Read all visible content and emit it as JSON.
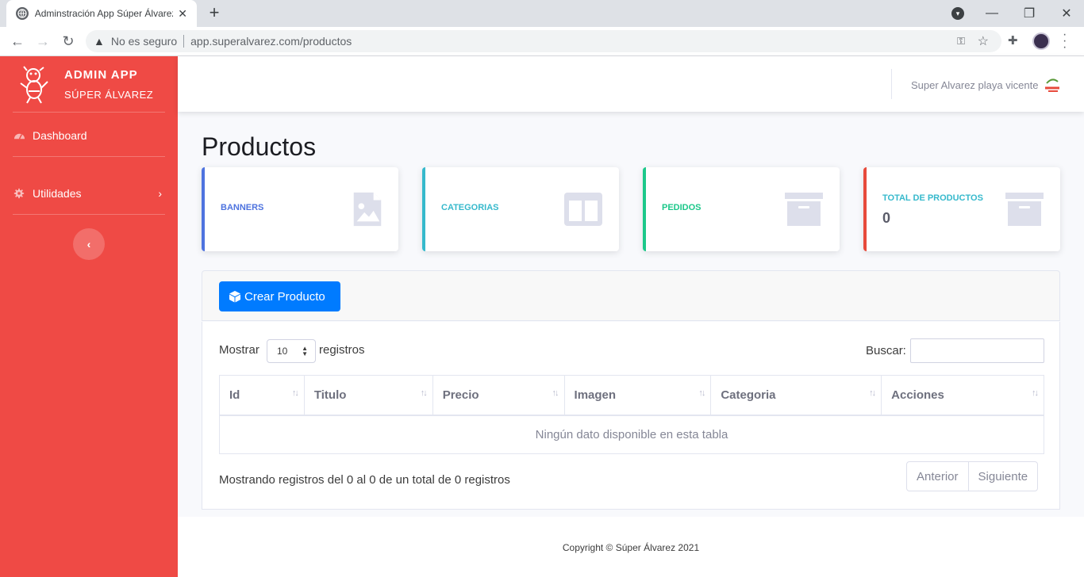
{
  "browser": {
    "tab_title": "Adminstración App Súper Álvarez",
    "not_secure": "No es seguro",
    "url": "app.superalvarez.com/productos"
  },
  "sidebar": {
    "brand_title": "ADMIN APP",
    "brand_subtitle": "SÚPER ÁLVAREZ",
    "items": [
      {
        "label": "Dashboard",
        "icon": "tachometer-icon"
      },
      {
        "label": "Utilidades",
        "icon": "gear-icon"
      }
    ]
  },
  "topbar": {
    "user_name": "Super Alvarez playa vicente"
  },
  "page": {
    "title": "Productos"
  },
  "cards": [
    {
      "label": "BANNERS",
      "value": "",
      "icon": "image-file-icon",
      "color": "#4e73df"
    },
    {
      "label": "CATEGORIAS",
      "value": "",
      "icon": "columns-icon",
      "color": "#36b9cc"
    },
    {
      "label": "PEDIDOS",
      "value": "",
      "icon": "archive-icon",
      "color": "#1cc88a"
    },
    {
      "label": "TOTAL DE PRODUCTOS",
      "value": "0",
      "icon": "archive-icon",
      "color": "#e74a3b"
    }
  ],
  "actions": {
    "create_label": "Crear Producto"
  },
  "table": {
    "show_label": "Mostrar",
    "page_size": "10",
    "records_label": "registros",
    "search_label": "Buscar:",
    "search_value": "",
    "columns": [
      "Id",
      "Titulo",
      "Precio",
      "Imagen",
      "Categoria",
      "Acciones"
    ],
    "empty_message": "Ningún dato disponible en esta tabla",
    "info": "Mostrando registros del 0 al 0 de un total de 0 registros",
    "prev_label": "Anterior",
    "next_label": "Siguiente"
  },
  "footer": {
    "copyright": "Copyright © Súper Álvarez 2021"
  }
}
